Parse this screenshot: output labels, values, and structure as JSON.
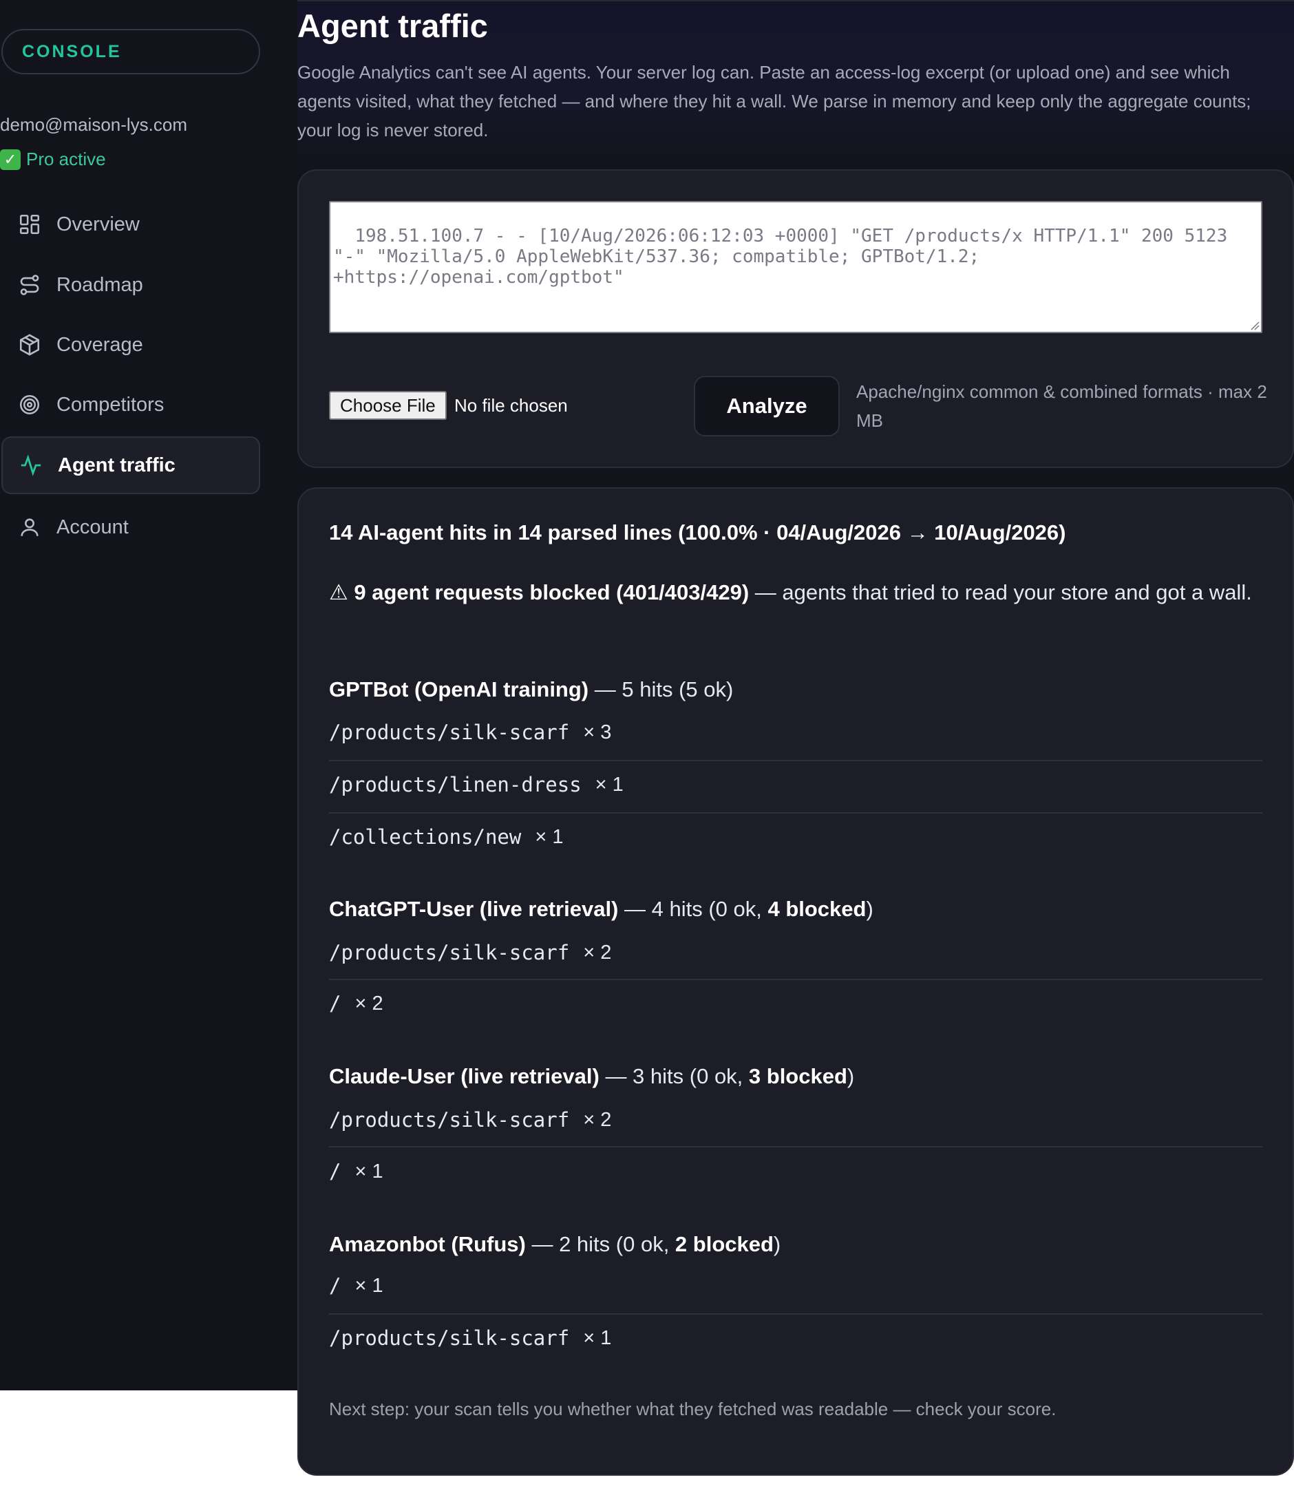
{
  "sidebar": {
    "console_label": "CONSOLE",
    "user_email": "demo@maison-lys.com",
    "plan_status": "Pro active",
    "items": [
      {
        "label": "Overview",
        "icon": "grid-icon"
      },
      {
        "label": "Roadmap",
        "icon": "route-icon"
      },
      {
        "label": "Coverage",
        "icon": "package-icon"
      },
      {
        "label": "Competitors",
        "icon": "target-icon"
      },
      {
        "label": "Agent traffic",
        "icon": "activity-icon",
        "active": true
      },
      {
        "label": "Account",
        "icon": "user-icon"
      }
    ]
  },
  "main": {
    "title": "Agent traffic",
    "intro": "Google Analytics can't see AI agents. Your server log can. Paste an access-log excerpt (or upload one) and see which agents visited, what they fetched — and where they hit a wall. We parse in memory and keep only the aggregate counts; your log is never stored.",
    "log_placeholder": "198.51.100.7 - - [10/Aug/2026:06:12:03 +0000] \"GET /products/x HTTP/1.1\" 200 5123\n\"-\" \"Mozilla/5.0 AppleWebKit/537.36; compatible; GPTBot/1.2;\n+https://openai.com/gptbot\"",
    "choose_file_label": "Choose File",
    "no_file_label": "No file chosen",
    "analyze_label": "Analyze",
    "format_hint": "Apache/nginx common & combined formats · max 2 MB"
  },
  "results": {
    "summary": "14 AI-agent hits in 14 parsed lines (100.0% · 04/Aug/2026 → 10/Aug/2026)",
    "blocked_icon": "warning-icon",
    "blocked_bold": "⚠ 9 agent requests blocked (401/403/429)",
    "blocked_rest": " — agents that tried to read your store and got a wall.",
    "agents": [
      {
        "name": "GPTBot (OpenAI training)",
        "stats_pre": " — 5 hits (5 ok)",
        "blocked": "",
        "stats_post": "",
        "paths": [
          {
            "path": "/products/silk-scarf",
            "count": "× 3"
          },
          {
            "path": "/products/linen-dress",
            "count": "× 1"
          },
          {
            "path": "/collections/new",
            "count": "× 1"
          }
        ]
      },
      {
        "name": "ChatGPT-User (live retrieval)",
        "stats_pre": " — 4 hits (0 ok, ",
        "blocked": "4 blocked",
        "stats_post": ")",
        "paths": [
          {
            "path": "/products/silk-scarf",
            "count": "× 2"
          },
          {
            "path": "/",
            "count": "× 2"
          }
        ]
      },
      {
        "name": "Claude-User (live retrieval)",
        "stats_pre": " — 3 hits (0 ok, ",
        "blocked": "3 blocked",
        "stats_post": ")",
        "paths": [
          {
            "path": "/products/silk-scarf",
            "count": "× 2"
          },
          {
            "path": "/",
            "count": "× 1"
          }
        ]
      },
      {
        "name": "Amazonbot (Rufus)",
        "stats_pre": " — 2 hits (0 ok, ",
        "blocked": "2 blocked",
        "stats_post": ")",
        "paths": [
          {
            "path": "/",
            "count": "× 1"
          },
          {
            "path": "/products/silk-scarf",
            "count": "× 1"
          }
        ]
      }
    ],
    "next_step": "Next step: your scan tells you whether what they fetched was readable — check your score."
  },
  "colors": {
    "accent": "#23c69a",
    "background": "#13131b",
    "card": "#1d1d28",
    "status_ok": "#3cc99a"
  }
}
